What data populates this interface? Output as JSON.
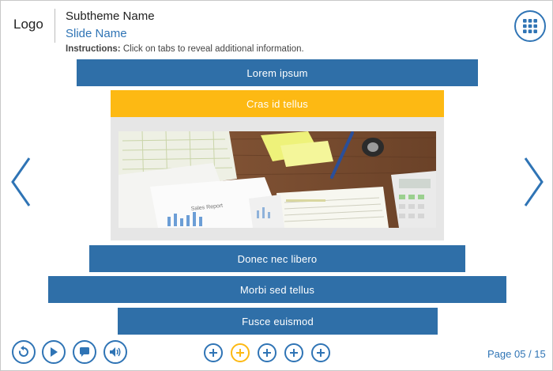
{
  "header": {
    "logo": "Logo",
    "subtheme": "Subtheme Name",
    "slide_name": "Slide Name",
    "instructions_label": "Instructions:",
    "instructions_text": " Click on tabs to reveal additional information.",
    "menu_icon": "grid-icon"
  },
  "tabs": [
    {
      "label": "Lorem ipsum",
      "active": false
    },
    {
      "label": "Cras id tellus",
      "active": true
    },
    {
      "label": "Donec nec libero",
      "active": false
    },
    {
      "label": "Morbi sed tellus",
      "active": false
    },
    {
      "label": "Fusce euismod",
      "active": false
    }
  ],
  "panel": {
    "image_text": "Sales Report",
    "image_subject": "desk-with-documents-calculator-stapler"
  },
  "navigation": {
    "prev_icon": "chevron-left-icon",
    "next_icon": "chevron-right-icon"
  },
  "controls": [
    {
      "icon": "replay-icon"
    },
    {
      "icon": "play-icon"
    },
    {
      "icon": "chat-icon"
    },
    {
      "icon": "audio-icon"
    }
  ],
  "page_dots": {
    "count": 5,
    "active_index": 1,
    "icon": "plus-icon"
  },
  "pager": {
    "text": "Page 05 / 15"
  },
  "colors": {
    "primary": "#2f6fa8",
    "accent": "#fdb913",
    "panel_bg": "#e6e6e6"
  }
}
